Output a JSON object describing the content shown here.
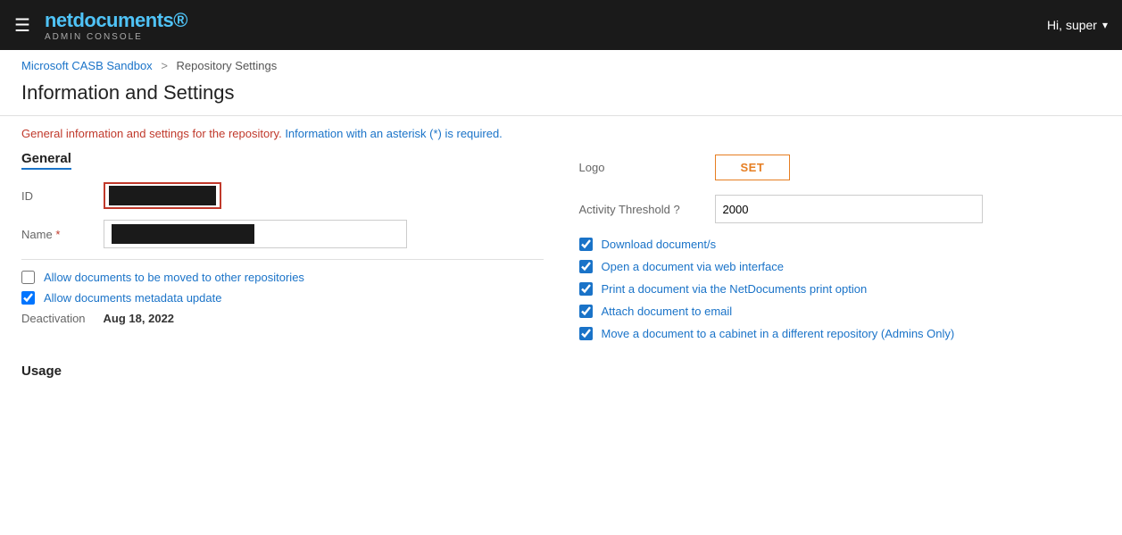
{
  "topnav": {
    "brand": "netdocuments",
    "brand_accent": "net",
    "brand_sub": "ADMIN CONSOLE",
    "user_greeting": "Hi, super",
    "hamburger_icon": "☰"
  },
  "breadcrumb": {
    "parent_label": "Microsoft CASB Sandbox",
    "parent_href": "#",
    "separator": ">",
    "current": "Repository Settings"
  },
  "page_title": "Information and Settings",
  "info_text_plain": "General information and settings for the repository. ",
  "info_text_blue": "Information with an asterisk (*) is required.",
  "general_section": {
    "heading": "General",
    "id_label": "ID",
    "name_label": "Name",
    "name_required": "*",
    "allow_move_label": "Allow documents to be moved to other repositories",
    "allow_move_checked": false,
    "allow_metadata_label": "Allow documents metadata update",
    "allow_metadata_checked": true,
    "deactivation_label": "Deactivation",
    "deactivation_date": "Aug 18, 2022"
  },
  "right_section": {
    "logo_label": "Logo",
    "set_button_label": "SET",
    "threshold_label": "Activity Threshold ?",
    "threshold_value": "2000",
    "checkboxes": [
      {
        "label": "Download document/s",
        "checked": true
      },
      {
        "label": "Open a document via web interface",
        "checked": true
      },
      {
        "label": "Print a document via the NetDocuments print option",
        "checked": true
      },
      {
        "label": "Attach document to email",
        "checked": true
      },
      {
        "label": "Move a document to a cabinet in a different repository (Admins Only)",
        "checked": true
      }
    ]
  },
  "usage_section": {
    "heading": "Usage"
  }
}
